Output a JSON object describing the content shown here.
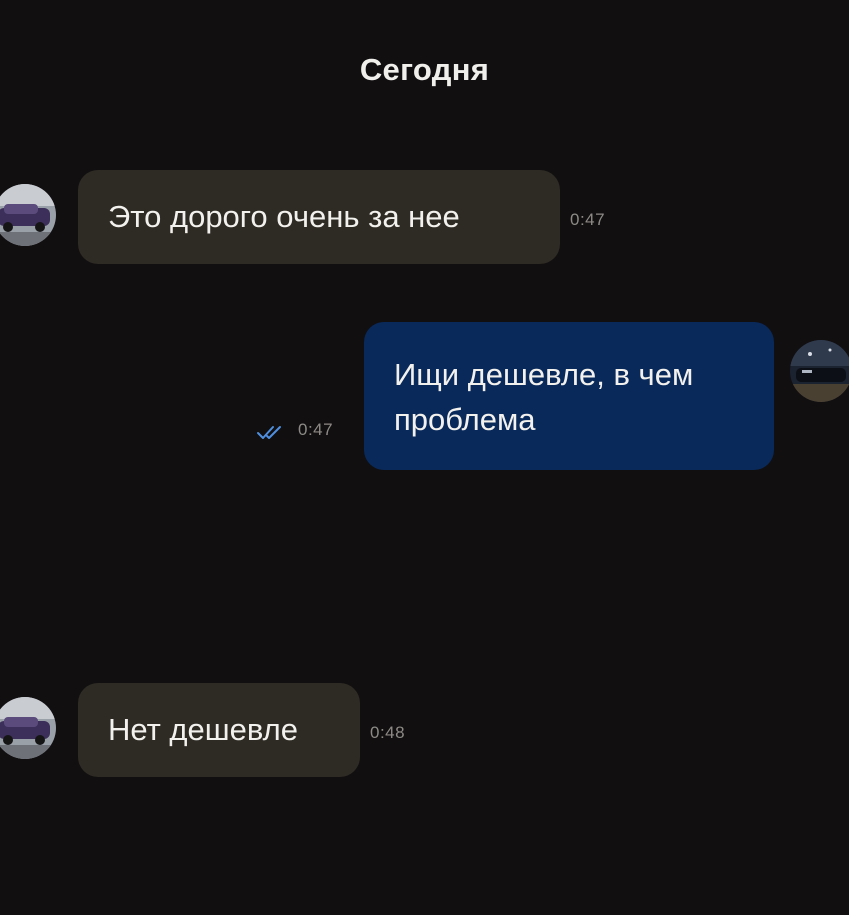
{
  "chat": {
    "date_header": "Сегодня",
    "messages": [
      {
        "direction": "incoming",
        "text": "Это дорого очень за нее",
        "time": "0:47"
      },
      {
        "direction": "outgoing",
        "text": "Ищи дешевле, в чем проблема",
        "time": "0:47",
        "status": "read"
      },
      {
        "direction": "incoming",
        "text": "Нет дешевле",
        "time": "0:48"
      }
    ]
  },
  "icons": {
    "read_receipt": "double-check-icon",
    "contact_avatar": "avatar-car-photo",
    "own_avatar": "avatar-night-car-photo"
  },
  "colors": {
    "background": "#110f10",
    "incoming_bubble": "#2e2a24",
    "outgoing_bubble": "#09295a",
    "read_check": "#4f8fe0",
    "timestamp": "#8d8a86"
  }
}
